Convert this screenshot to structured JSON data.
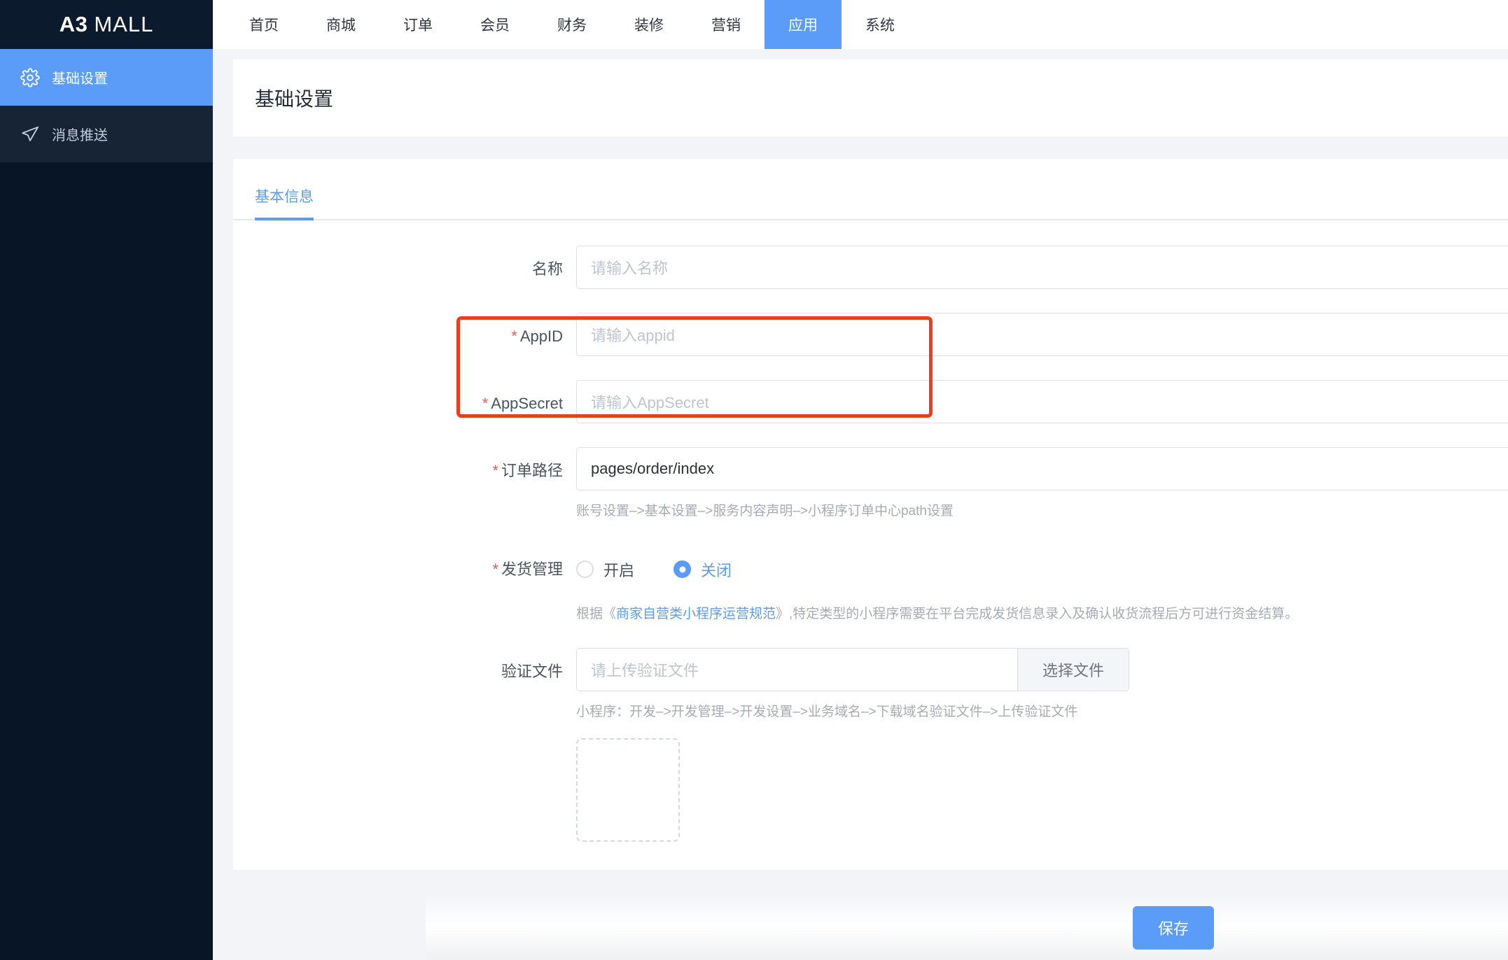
{
  "brand": {
    "strong": "A3",
    "light": "MALL"
  },
  "sidebar": {
    "items": [
      {
        "label": "基础设置",
        "icon": "gear-icon",
        "active": true
      },
      {
        "label": "消息推送",
        "icon": "send-icon",
        "active": false
      }
    ]
  },
  "topnav": {
    "items": [
      {
        "label": "首页",
        "active": false
      },
      {
        "label": "商城",
        "active": false
      },
      {
        "label": "订单",
        "active": false
      },
      {
        "label": "会员",
        "active": false
      },
      {
        "label": "财务",
        "active": false
      },
      {
        "label": "装修",
        "active": false
      },
      {
        "label": "营销",
        "active": false
      },
      {
        "label": "应用",
        "active": true
      },
      {
        "label": "系统",
        "active": false
      }
    ]
  },
  "page": {
    "title": "基础设置"
  },
  "tabs": [
    {
      "label": "基本信息",
      "active": true
    }
  ],
  "form": {
    "name": {
      "label": "名称",
      "required": false,
      "value": "",
      "placeholder": "请输入名称"
    },
    "appid": {
      "label": "AppID",
      "required_mark": "*",
      "value": "",
      "placeholder": "请输入appid"
    },
    "appsecret": {
      "label": "AppSecret",
      "required_mark": "*",
      "value": "",
      "placeholder": "请输入AppSecret"
    },
    "order_path": {
      "label": "订单路径",
      "required_mark": "*",
      "value": "pages/order/index",
      "hint": "账号设置–>基本设置–>服务内容声明–>小程序订单中心path设置"
    },
    "shipping": {
      "label": "发货管理",
      "required_mark": "*",
      "options": [
        {
          "label": "开启",
          "selected": false
        },
        {
          "label": "关闭",
          "selected": true
        }
      ],
      "hint_prefix": "根据《",
      "hint_link": "商家自营类小程序运营规范",
      "hint_suffix": "》,特定类型的小程序需要在平台完成发货信息录入及确认收货流程后方可进行资金结算。"
    },
    "verify_file": {
      "label": "验证文件",
      "required": false,
      "value": "",
      "placeholder": "请上传验证文件",
      "button_label": "选择文件",
      "hint": "小程序：开发–>开发管理–>开发设置–>业务域名–>下载域名验证文件–>上传验证文件"
    }
  },
  "footer": {
    "save_label": "保存"
  },
  "colors": {
    "accent": "#5b9cf8",
    "sidebar_dark": "#071527",
    "sidebar_item": "#172435",
    "required_red": "#f05a4f",
    "highlight_red": "#e8401f",
    "page_bg": "#f2f4f7"
  }
}
